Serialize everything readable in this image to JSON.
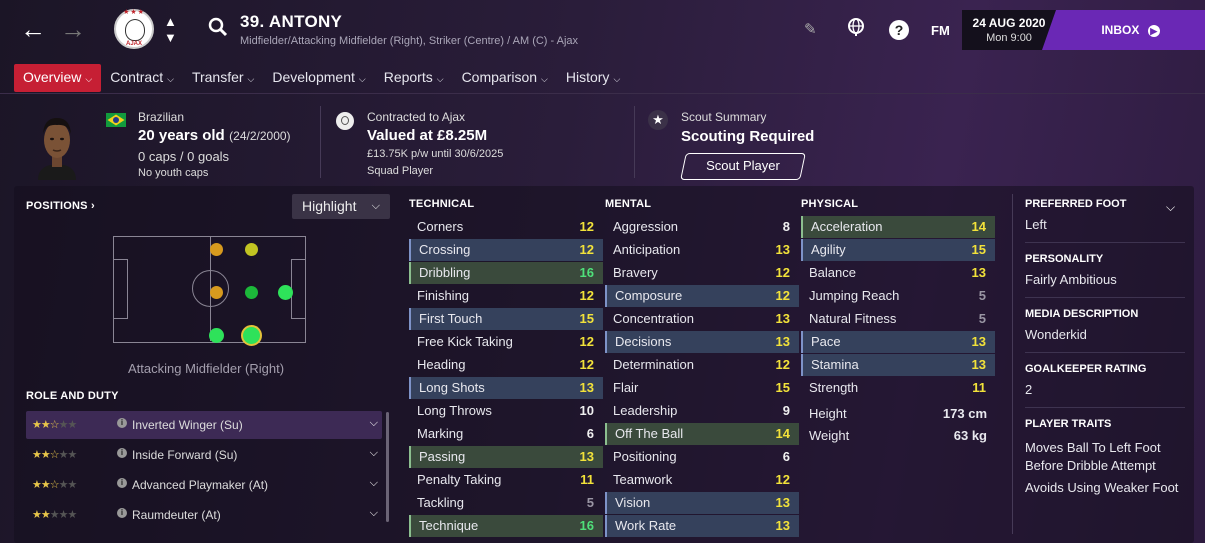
{
  "header": {
    "player_title": "39. ANTONY",
    "player_subtitle": "Midfielder/Attacking Midfielder (Right), Striker (Centre) / AM (C) - Ajax",
    "club_crest_text": "AJAX",
    "date": "24 AUG 2020",
    "time": "Mon 9:00",
    "fm_label": "FM",
    "inbox_label": "INBOX"
  },
  "nav": [
    {
      "label": "Overview",
      "active": true
    },
    {
      "label": "Contract"
    },
    {
      "label": "Transfer"
    },
    {
      "label": "Development"
    },
    {
      "label": "Reports"
    },
    {
      "label": "Comparison"
    },
    {
      "label": "History"
    }
  ],
  "profile": {
    "nationality": "Brazilian",
    "age": "20 years old",
    "dob": "(24/2/2000)",
    "caps": "0 caps / 0 goals",
    "youth_caps": "No youth caps"
  },
  "contract": {
    "header": "Contracted to Ajax",
    "value": "Valued at £8.25M",
    "wage": "£13.75K p/w until 30/6/2025",
    "status": "Squad Player"
  },
  "scout": {
    "header": "Scout Summary",
    "status": "Scouting Required",
    "button": "Scout Player"
  },
  "positions": {
    "title": "POSITIONS",
    "highlight": "Highlight",
    "position_label": "Attacking Midfielder (Right)"
  },
  "roles": {
    "title": "ROLE AND DUTY",
    "items": [
      {
        "name": "Inverted Winger (Su)",
        "stars": 2.5
      },
      {
        "name": "Inside Forward (Su)",
        "stars": 2.5
      },
      {
        "name": "Advanced Playmaker (At)",
        "stars": 2.5
      },
      {
        "name": "Raumdeuter (At)",
        "stars": 2
      }
    ]
  },
  "technical": {
    "title": "TECHNICAL",
    "items": [
      {
        "name": "Corners",
        "value": "12",
        "style": "lo"
      },
      {
        "name": "Crossing",
        "value": "12",
        "style": "hi"
      },
      {
        "name": "Dribbling",
        "value": "16",
        "style": "g"
      },
      {
        "name": "Finishing",
        "value": "12",
        "style": "lo"
      },
      {
        "name": "First Touch",
        "value": "15",
        "style": "hi"
      },
      {
        "name": "Free Kick Taking",
        "value": "12",
        "style": "lo"
      },
      {
        "name": "Heading",
        "value": "12",
        "style": "lo"
      },
      {
        "name": "Long Shots",
        "value": "13",
        "style": "hi"
      },
      {
        "name": "Long Throws",
        "value": "10",
        "style": "lo"
      },
      {
        "name": "Marking",
        "value": "6",
        "style": "lo"
      },
      {
        "name": "Passing",
        "value": "13",
        "style": "g"
      },
      {
        "name": "Penalty Taking",
        "value": "11",
        "style": "lo"
      },
      {
        "name": "Tackling",
        "value": "5",
        "style": "lo"
      },
      {
        "name": "Technique",
        "value": "16",
        "style": "g"
      }
    ]
  },
  "mental": {
    "title": "MENTAL",
    "items": [
      {
        "name": "Aggression",
        "value": "8",
        "style": "lo"
      },
      {
        "name": "Anticipation",
        "value": "13",
        "style": "lo"
      },
      {
        "name": "Bravery",
        "value": "12",
        "style": "lo"
      },
      {
        "name": "Composure",
        "value": "12",
        "style": "hi"
      },
      {
        "name": "Concentration",
        "value": "13",
        "style": "lo"
      },
      {
        "name": "Decisions",
        "value": "13",
        "style": "hi"
      },
      {
        "name": "Determination",
        "value": "12",
        "style": "lo"
      },
      {
        "name": "Flair",
        "value": "15",
        "style": "lo"
      },
      {
        "name": "Leadership",
        "value": "9",
        "style": "lo"
      },
      {
        "name": "Off The Ball",
        "value": "14",
        "style": "g"
      },
      {
        "name": "Positioning",
        "value": "6",
        "style": "lo"
      },
      {
        "name": "Teamwork",
        "value": "12",
        "style": "lo"
      },
      {
        "name": "Vision",
        "value": "13",
        "style": "hi"
      },
      {
        "name": "Work Rate",
        "value": "13",
        "style": "hi"
      }
    ]
  },
  "physical": {
    "title": "PHYSICAL",
    "items": [
      {
        "name": "Acceleration",
        "value": "14",
        "style": "g"
      },
      {
        "name": "Agility",
        "value": "15",
        "style": "hi"
      },
      {
        "name": "Balance",
        "value": "13",
        "style": "lo"
      },
      {
        "name": "Jumping Reach",
        "value": "5",
        "style": "lo"
      },
      {
        "name": "Natural Fitness",
        "value": "5",
        "style": "lo"
      },
      {
        "name": "Pace",
        "value": "13",
        "style": "hi"
      },
      {
        "name": "Stamina",
        "value": "13",
        "style": "hi"
      },
      {
        "name": "Strength",
        "value": "11",
        "style": "lo"
      }
    ],
    "height_label": "Height",
    "height": "173 cm",
    "weight_label": "Weight",
    "weight": "63 kg"
  },
  "details": {
    "foot_label": "PREFERRED FOOT",
    "foot": "Left",
    "personality_label": "PERSONALITY",
    "personality": "Fairly Ambitious",
    "media_label": "MEDIA DESCRIPTION",
    "media": "Wonderkid",
    "gk_label": "GOALKEEPER RATING",
    "gk": "2",
    "traits_label": "PLAYER TRAITS",
    "traits": [
      "Moves Ball To Left Foot Before Dribble Attempt",
      "Avoids Using Weaker Foot"
    ]
  },
  "colors": {
    "accent_red": "#c61f34",
    "inbox_purple": "#6a28b5",
    "value_yellow": "#f2e23a",
    "value_green": "#4fe07a",
    "value_white": "#f0f0f0",
    "value_grey": "#9a96a4"
  }
}
